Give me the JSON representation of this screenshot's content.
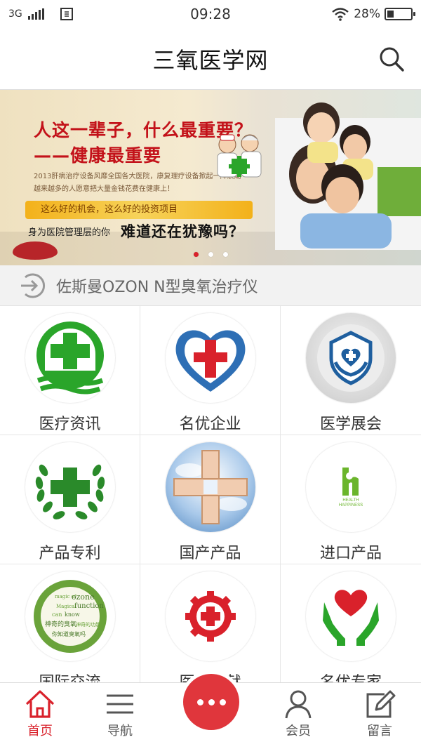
{
  "status_bar": {
    "network": "3G",
    "time": "09:28",
    "battery": "28%",
    "battery_level": 0.28
  },
  "header": {
    "title": "三氧医学网"
  },
  "banner": {
    "headline_1": "人这一辈子，什么最重要？",
    "headline_2": "——健康最重要",
    "line_1": "2013肝病治疗设备风靡全国各大医院，康复理疗设备掀起一阵浪潮",
    "line_2": "越来越多的人愿意把大量金钱花费在健康上！",
    "ribbon": "这么好的机会，这么好的投资项目",
    "question_small": "身为医院管理层的你",
    "question_big": "难道还在犹豫吗？",
    "slide_count": 3,
    "active_slide": 1
  },
  "notice": {
    "text": "佐斯曼OZON N型臭氧治疗仪"
  },
  "grid": {
    "items": [
      {
        "label": "医疗资讯",
        "icon": "green-cross-icon"
      },
      {
        "label": "名优企业",
        "icon": "heart-cross-icon"
      },
      {
        "label": "医学展会",
        "icon": "shield-hands-icon"
      },
      {
        "label": "产品专利",
        "icon": "laurel-cross-icon"
      },
      {
        "label": "国产产品",
        "icon": "hands-cross-photo-icon"
      },
      {
        "label": "进口产品",
        "icon": "health-happiness-icon"
      },
      {
        "label": "国际交流",
        "icon": "ozone-wreath-icon"
      },
      {
        "label": "医学文献",
        "icon": "red-gear-cross-icon"
      },
      {
        "label": "名优专家",
        "icon": "hands-heart-icon"
      }
    ],
    "health_logo": {
      "line_1": "HEALTH",
      "line_2": "HAPPINESS"
    },
    "ozone_words": {
      "w1": "magic of",
      "w2": "ozone",
      "w3": "Magical",
      "w4": "function",
      "w5": "can",
      "w6": "know",
      "w7": "神奇的臭氧",
      "w8": "神奇的功能",
      "w9": "你知道臭氧吗"
    }
  },
  "bottom_nav": {
    "home": "首页",
    "nav": "导航",
    "member": "会员",
    "message": "留言"
  },
  "colors": {
    "accent": "#d9212b",
    "green": "#2aa52a",
    "blue": "#2e6fb5"
  }
}
